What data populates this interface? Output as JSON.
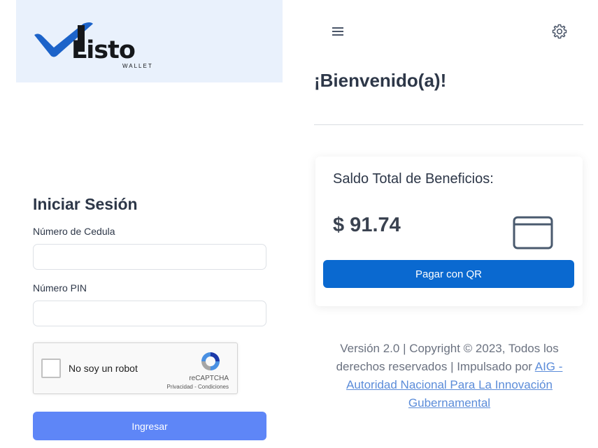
{
  "brand": {
    "logo_text": "Listo",
    "logo_subtext": "WALLET",
    "colors": {
      "blue": "#1c63c9",
      "dark": "#15171a"
    }
  },
  "login": {
    "title": "Iniciar Sesión",
    "cedula_label": "Número de Cedula",
    "cedula_value": "",
    "pin_label": "Número PIN",
    "pin_value": "",
    "captcha": {
      "label": "No soy un robot",
      "brand": "reCAPTCHA",
      "links": "Privacidad - Condiciones",
      "icon": "recaptcha-icon",
      "checked": false
    },
    "submit_label": "Ingresar",
    "submit_color": "#5e86f7"
  },
  "header": {
    "menu_icon": "hamburger-menu-icon",
    "settings_icon": "gear-icon"
  },
  "welcome": "¡Bienvenido(a)!",
  "balance": {
    "title": "Saldo Total de Beneficios:",
    "amount": "$ 91.74",
    "icon": "wallet-icon",
    "pay_button": "Pagar con QR",
    "pay_color": "#0a69d0"
  },
  "footer": {
    "text": "Versión 2.0 | Copyright © 2023, Todos los derechos reservados | Impulsado por ",
    "link": "AIG - Autoridad Nacional Para La Innovación Gubernamental"
  }
}
